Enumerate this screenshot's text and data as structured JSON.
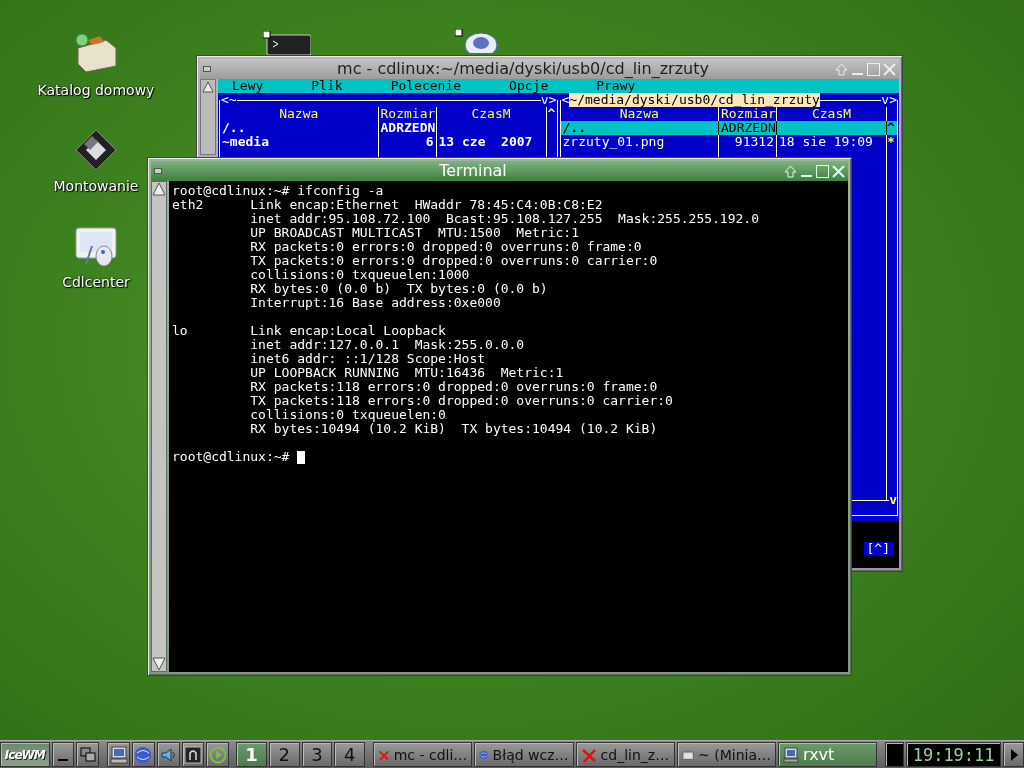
{
  "desktop_icons": [
    {
      "label": "Katalog domowy",
      "kind": "folder"
    },
    {
      "label": "Montowanie",
      "kind": "floppy"
    },
    {
      "label": "Cdlcenter",
      "kind": "tablet"
    }
  ],
  "mc_window": {
    "title": "mc - cdlinux:~/media/dyski/usb0/cd_lin_zrzuty",
    "menu": [
      "Lewy",
      "Plik",
      "Polecenie",
      "Opcje",
      "Prawy"
    ],
    "left_panel": {
      "open": "<",
      "path": "~",
      "close": "v>",
      "header_mark": "^",
      "columns": [
        "Nazwa",
        "Rozmiar",
        "CzasM"
      ],
      "rows": [
        {
          "name": "/..",
          "size": "ADRZEDN",
          "time": "",
          "selected": false
        },
        {
          "name": "~media",
          "size": "6",
          "time": "13 cze  2007",
          "selected": false
        }
      ]
    },
    "right_panel": {
      "open": "<",
      "path": "~/media/dyski/usb0/cd_lin_zrzuty",
      "close": "v>",
      "scroll_down": "v",
      "columns": [
        "Nazwa",
        "Rozmiar",
        "CzasM"
      ],
      "rows": [
        {
          "name": "/..",
          "size": "ADRZEDN",
          "time": "",
          "selected": true,
          "mark": "^"
        },
        {
          "name": "zrzuty_01.png",
          "size": "91312",
          "time": "18 sie 19:09",
          "selected": false,
          "mark": "*"
        }
      ]
    },
    "hint": "[^]"
  },
  "terminal": {
    "title": "Terminal",
    "blocks": [
      [
        "root@cdlinux:~# ifconfig -a",
        "eth2      Link encap:Ethernet  HWaddr 78:45:C4:0B:C8:E2",
        "          inet addr:95.108.72.100  Bcast:95.108.127.255  Mask:255.255.192.0",
        "          UP BROADCAST MULTICAST  MTU:1500  Metric:1",
        "          RX packets:0 errors:0 dropped:0 overruns:0 frame:0",
        "          TX packets:0 errors:0 dropped:0 overruns:0 carrier:0",
        "          collisions:0 txqueuelen:1000",
        "          RX bytes:0 (0.0 b)  TX bytes:0 (0.0 b)",
        "          Interrupt:16 Base address:0xe000"
      ],
      [
        "lo        Link encap:Local Loopback",
        "          inet addr:127.0.0.1  Mask:255.0.0.0",
        "          inet6 addr: ::1/128 Scope:Host",
        "          UP LOOPBACK RUNNING  MTU:16436  Metric:1",
        "          RX packets:118 errors:0 dropped:0 overruns:0 frame:0",
        "          TX packets:118 errors:0 dropped:0 overruns:0 carrier:0",
        "          collisions:0 txqueuelen:0",
        "          RX bytes:10494 (10.2 KiB)  TX bytes:10494 (10.2 KiB)"
      ]
    ],
    "prompt": "root@cdlinux:~#",
    "cursor": true
  },
  "taskbar": {
    "start_label": "IceWM",
    "workspaces": [
      {
        "label": "1",
        "selected": true
      },
      {
        "label": "2",
        "selected": false
      },
      {
        "label": "3",
        "selected": false
      },
      {
        "label": "4",
        "selected": false
      }
    ],
    "tasks": [
      {
        "label": "mc - cdli…",
        "kind": "cross",
        "selected": false
      },
      {
        "label": "Błąd wcz…",
        "kind": "globe",
        "selected": false
      },
      {
        "label": "cd_lin_z…",
        "kind": "cross",
        "selected": false
      },
      {
        "label": "~ (Minia…",
        "kind": "folder",
        "selected": false
      },
      {
        "label": "rxvt",
        "kind": "monitor",
        "selected": true
      }
    ],
    "clock": "19:19:11"
  }
}
